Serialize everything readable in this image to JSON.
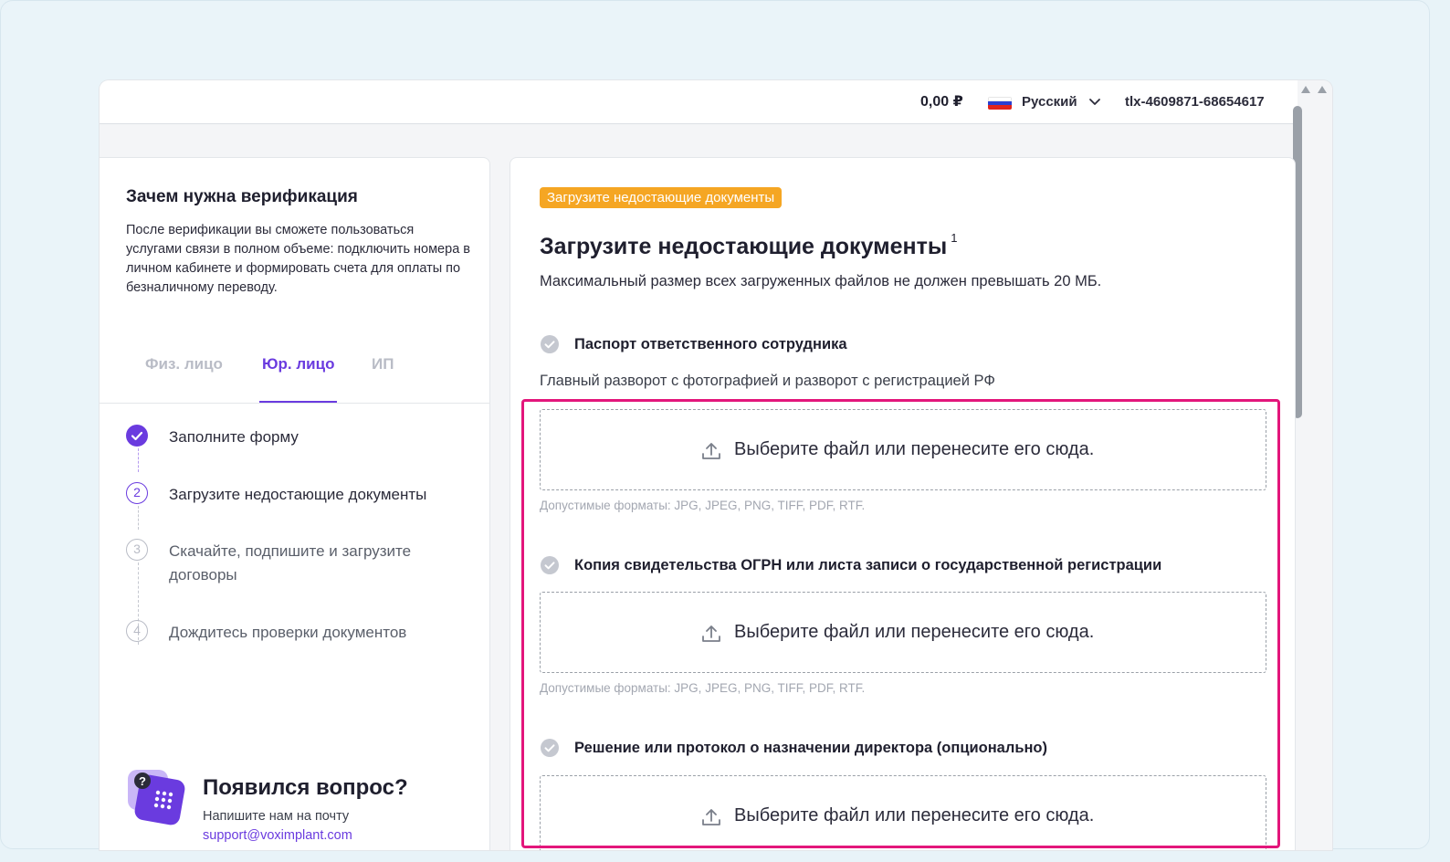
{
  "header": {
    "balance": "0,00 ₽",
    "language": "Русский",
    "account_id": "tlx-4609871-68654617"
  },
  "left": {
    "why_title": "Зачем нужна верификация",
    "why_text": "После верификации вы сможете пользоваться услугами связи в полном объеме: подключить номера в личном кабинете и формировать счета для оплаты по безналичному переводу.",
    "tabs": [
      {
        "label": "Физ. лицо",
        "active": false
      },
      {
        "label": "Юр. лицо",
        "active": true
      },
      {
        "label": "ИП",
        "active": false
      }
    ],
    "steps": [
      {
        "num": "1",
        "label": "Заполните форму",
        "state": "done"
      },
      {
        "num": "2",
        "label": "Загрузите недостающие документы",
        "state": "current"
      },
      {
        "num": "3",
        "label": "Скачайте, подпишите и загрузите договоры",
        "state": "todo"
      },
      {
        "num": "4",
        "label": "Дождитесь проверки документов",
        "state": "todo"
      }
    ],
    "help": {
      "title": "Появился вопрос?",
      "text": "Напишите нам на почту",
      "email": "support@voximplant.com"
    }
  },
  "main": {
    "badge": "Загрузите недостающие документы",
    "title": "Загрузите недостающие документы",
    "title_sup": "1",
    "subtitle": "Максимальный размер всех загруженных файлов не должен превышать 20 МБ.",
    "documents": [
      {
        "title": "Паспорт ответственного сотрудника",
        "hint": "Главный разворот с фотографией и разворот с регистрацией РФ",
        "dropzone": "Выберите файл или перенесите его сюда.",
        "formats": "Допустимые форматы: JPG, JPEG, PNG, TIFF, PDF, RTF."
      },
      {
        "title": "Копия свидетельства ОГРН или листа записи о государственной регистрации",
        "dropzone": "Выберите файл или перенесите его сюда.",
        "formats": "Допустимые форматы: JPG, JPEG, PNG, TIFF, PDF, RTF."
      },
      {
        "title": "Решение или протокол о назначении директора (опционально)",
        "dropzone": "Выберите файл или перенесите его сюда."
      }
    ]
  },
  "colors": {
    "accent": "#6a3bdf",
    "badge": "#f5a623",
    "highlight": "#e3167b"
  }
}
